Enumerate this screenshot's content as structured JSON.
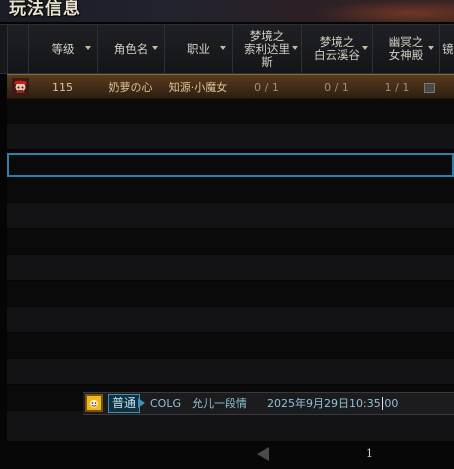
{
  "window": {
    "title": "玩法信息"
  },
  "table": {
    "columns": [
      {
        "label": "等级",
        "sortable": true
      },
      {
        "label": "角色名",
        "sortable": true
      },
      {
        "label": "职业",
        "sortable": true
      },
      {
        "label": "梦境之\n索利达里\n斯",
        "sortable": true
      },
      {
        "label": "梦境之\n白云溪谷",
        "sortable": true
      },
      {
        "label": "幽冥之\n女神殿",
        "sortable": true
      },
      {
        "label": "镜",
        "sortable": true
      }
    ],
    "rows": [
      {
        "level": "115",
        "name": "奶萝の心",
        "class": "知源·小魔女",
        "dream_solidaris": "0 / 1",
        "dream_white_cloud": "0 / 1",
        "netherworld_temple": "1 / 1"
      }
    ],
    "selected_row_index": 3
  },
  "chat": {
    "channel": "普通",
    "sender": "COLG",
    "message": "允儿一段情",
    "timestamp": "2025年9月29日10:35:00"
  },
  "pagination": {
    "current_page": "1"
  },
  "colors": {
    "accent_blue": "#2c7fae",
    "row_highlight": "#5a3a1c",
    "header_bg": "#17181c"
  }
}
